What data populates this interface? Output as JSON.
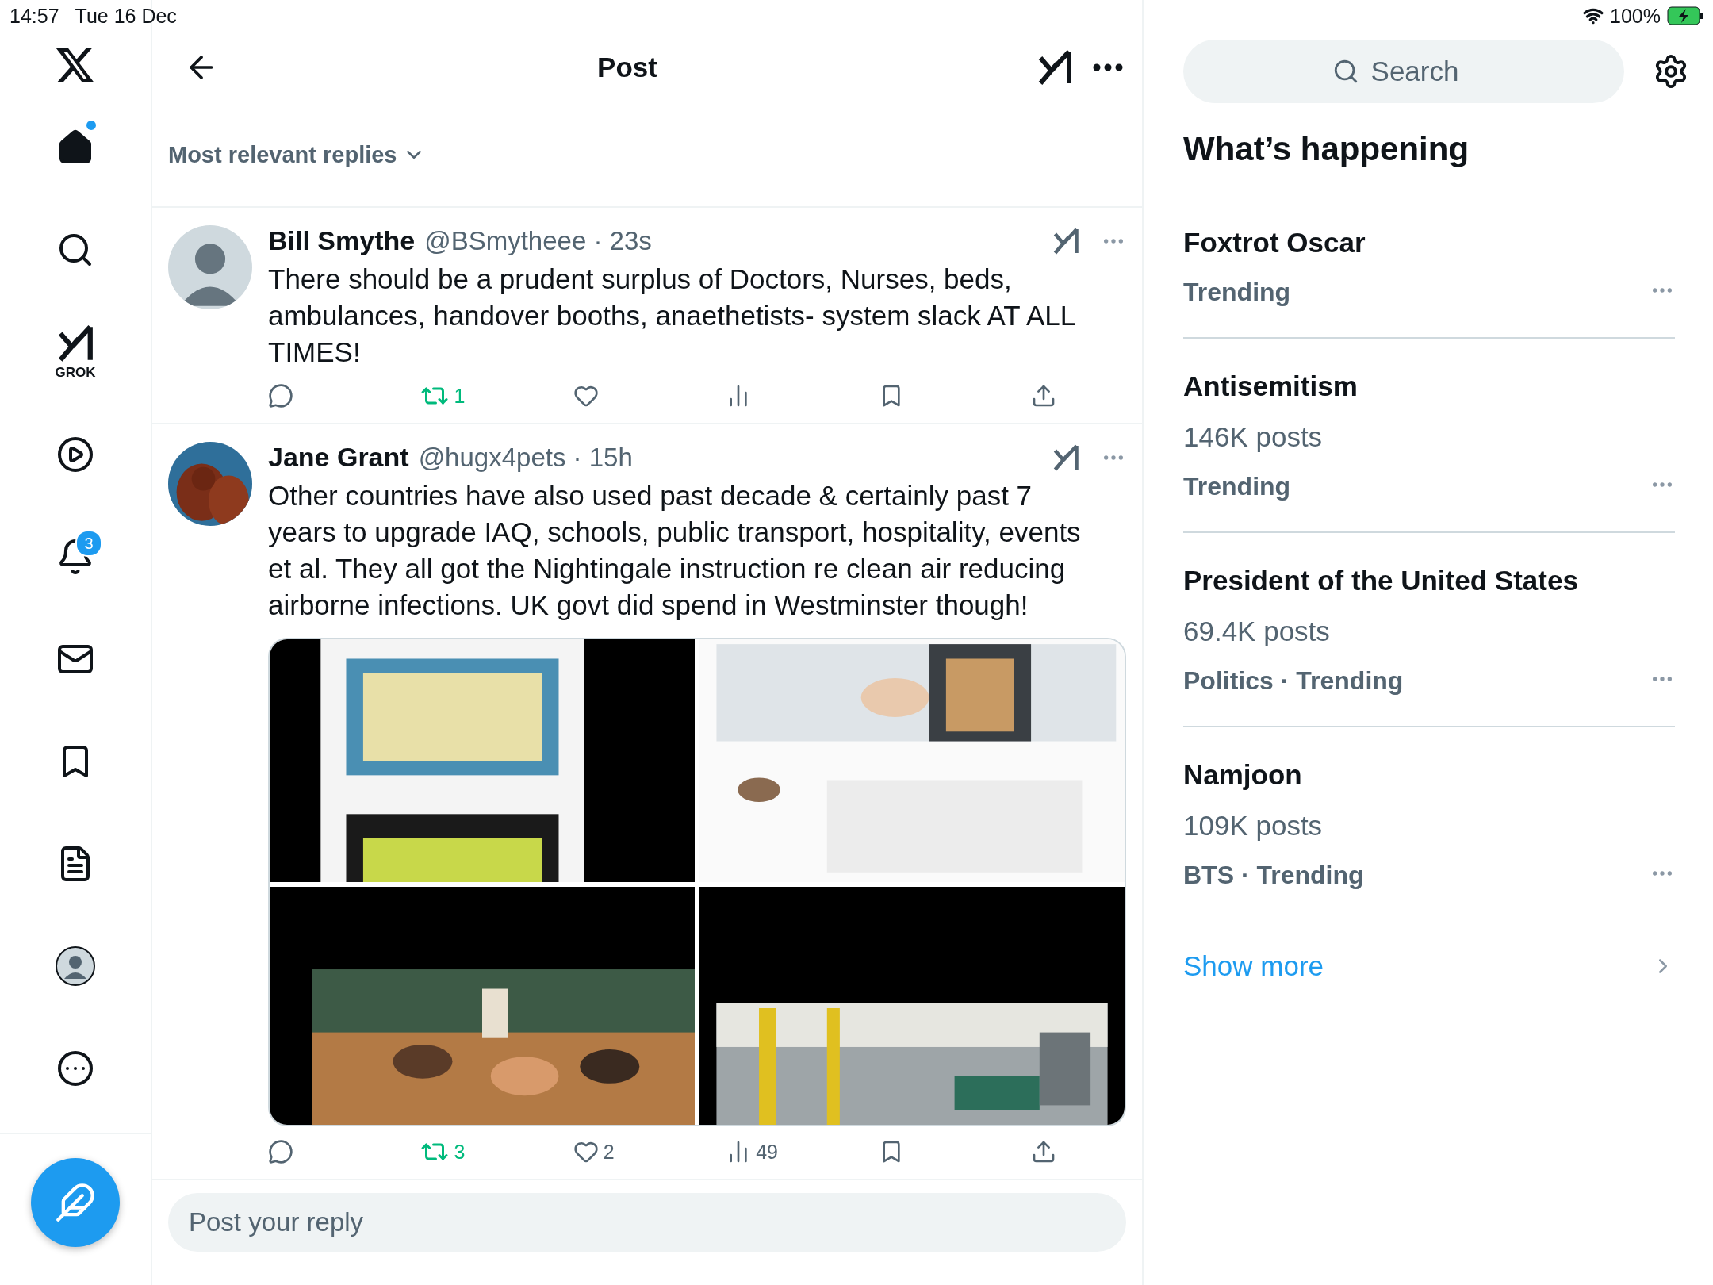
{
  "status_bar": {
    "time": "14:57",
    "date": "Tue 16 Dec",
    "battery": "100%"
  },
  "sidebar": {
    "items": [
      {
        "kind": "home",
        "new": true
      },
      {
        "kind": "search"
      },
      {
        "kind": "grok",
        "label": "GROK"
      },
      {
        "kind": "video"
      },
      {
        "kind": "notifications",
        "badge": "3"
      },
      {
        "kind": "messages"
      },
      {
        "kind": "bookmarks"
      },
      {
        "kind": "lists"
      },
      {
        "kind": "profile"
      },
      {
        "kind": "more"
      }
    ]
  },
  "header": {
    "title": "Post"
  },
  "sort": {
    "label": "Most relevant replies"
  },
  "posts": [
    {
      "avatar": {
        "kind": "silhouette"
      },
      "name": "Bill Smythe",
      "handle": "@BSmytheee",
      "time": "· 23s",
      "text": "There should be a prudent surplus of Doctors, Nurses, beds, ambulances, handover booths, anaethetists- system slack AT ALL TIMES!",
      "reposted": true,
      "reposts": "1"
    },
    {
      "name": "Jane Grant",
      "handle": "@hugx4pets",
      "time": "· 15h",
      "text": "Other countries have also used past decade & certainly past 7 years to upgrade IAQ, schools, public transport, hospitality, events et al. They all got the Nightingale instruction re clean air reducing airborne infections. UK govt did spend in Westminster though!",
      "reposted": true,
      "reposts": "3",
      "likes": "2",
      "views": "49"
    }
  ],
  "reply": {
    "placeholder": "Post your reply"
  },
  "search": {
    "placeholder": "Search"
  },
  "trends": {
    "title": "What’s happening",
    "items": [
      {
        "title": "Foxtrot Oscar",
        "context": "Trending"
      },
      {
        "title": "Antisemitism",
        "posts": "146K posts",
        "context": "Trending"
      },
      {
        "title": "President of the United States",
        "posts": "69.4K posts",
        "context": "Politics · Trending"
      },
      {
        "title": "Namjoon",
        "posts": "109K posts",
        "context": "BTS · Trending"
      }
    ],
    "show_more": "Show more"
  }
}
